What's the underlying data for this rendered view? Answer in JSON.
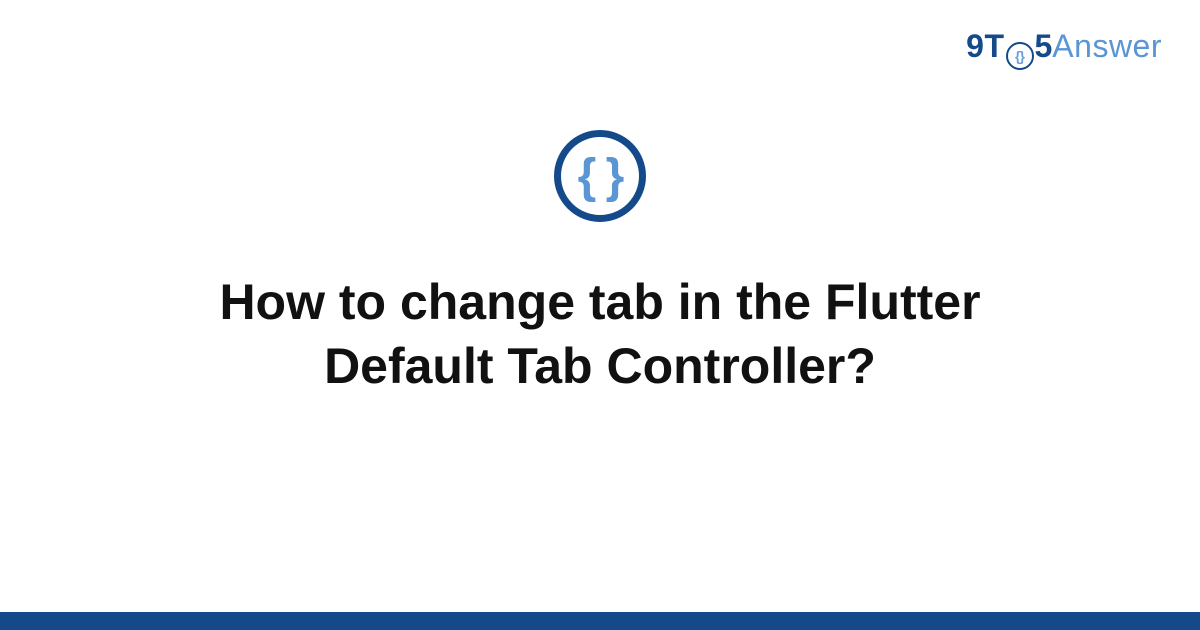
{
  "logo": {
    "part1": "9T",
    "o_inner": "{}",
    "part2": "5",
    "part3": "Answer"
  },
  "icon": {
    "braces": "{ }"
  },
  "title": "How to change tab in the Flutter Default Tab Controller?",
  "colors": {
    "brand_dark": "#154a8a",
    "brand_light": "#5a95d4",
    "text": "#111111",
    "background": "#ffffff"
  }
}
